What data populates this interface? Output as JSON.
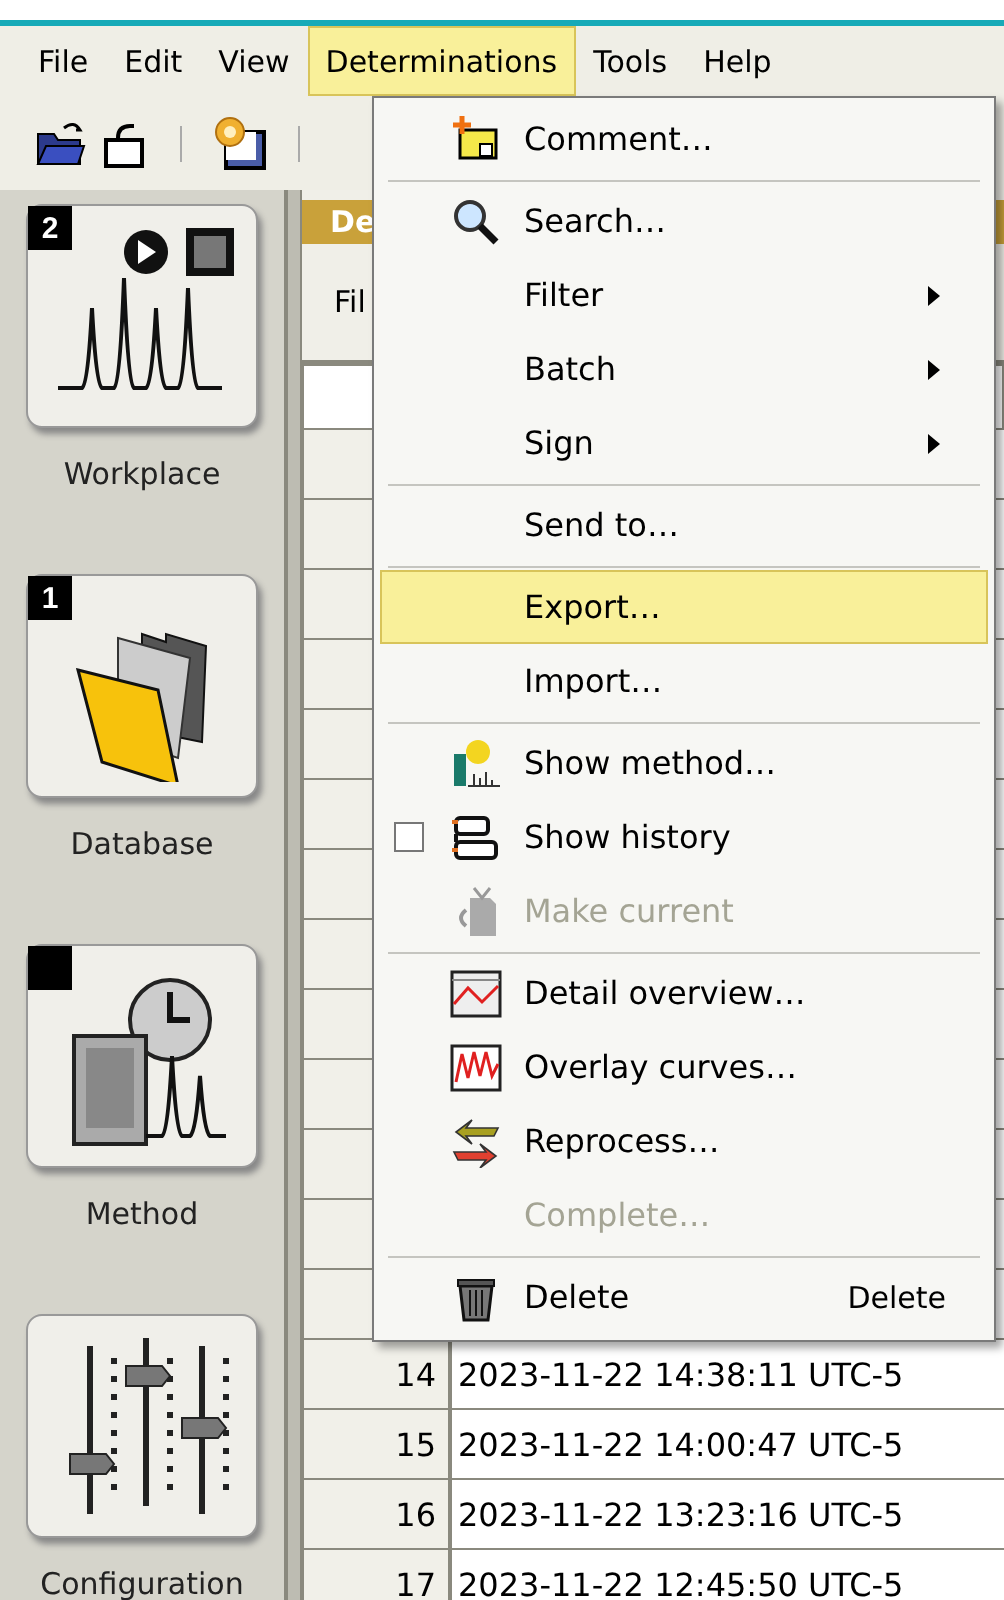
{
  "menubar": [
    {
      "label": "File",
      "selected": false
    },
    {
      "label": "Edit",
      "selected": false
    },
    {
      "label": "View",
      "selected": false
    },
    {
      "label": "Determinations",
      "selected": true
    },
    {
      "label": "Tools",
      "selected": false
    },
    {
      "label": "Help",
      "selected": false
    }
  ],
  "sidebar": {
    "items": [
      {
        "label": "Workplace",
        "kind": "workplace",
        "indicator": true,
        "badge": "2"
      },
      {
        "label": "Database",
        "kind": "database",
        "indicator": true,
        "badge": "1"
      },
      {
        "label": "Method",
        "kind": "method",
        "indicator": true
      },
      {
        "label": "Configuration",
        "kind": "configuration",
        "indicator": false
      }
    ]
  },
  "panel": {
    "tab_title": "De",
    "filter_label": "Fil"
  },
  "table": {
    "rows": [
      {
        "number": "14",
        "date": "2023-11-22 14:38:11 UTC-5"
      },
      {
        "number": "15",
        "date": "2023-11-22 14:00:47 UTC-5"
      },
      {
        "number": "16",
        "date": "2023-11-22 13:23:16 UTC-5"
      },
      {
        "number": "17",
        "date": "2023-11-22 12:45:50 UTC-5"
      }
    ]
  },
  "menu": {
    "items": [
      {
        "kind": "item",
        "label": "Comment…",
        "submenu": false,
        "disabled": false,
        "selected": false
      },
      {
        "kind": "separator"
      },
      {
        "kind": "item",
        "label": "Search…",
        "submenu": false,
        "disabled": false,
        "selected": false
      },
      {
        "kind": "item",
        "label": "Filter",
        "submenu": true,
        "disabled": false,
        "selected": false
      },
      {
        "kind": "item",
        "label": "Batch",
        "submenu": true,
        "disabled": false,
        "selected": false
      },
      {
        "kind": "item",
        "label": "Sign",
        "submenu": true,
        "disabled": false,
        "selected": false
      },
      {
        "kind": "separator"
      },
      {
        "kind": "item",
        "label": "Send to…",
        "submenu": false,
        "disabled": false,
        "selected": false
      },
      {
        "kind": "separator"
      },
      {
        "kind": "item",
        "label": "Export…",
        "submenu": false,
        "disabled": false,
        "selected": true
      },
      {
        "kind": "item",
        "label": "Import…",
        "submenu": false,
        "disabled": false,
        "selected": false
      },
      {
        "kind": "separator"
      },
      {
        "kind": "item",
        "label": "Show method…",
        "submenu": false,
        "disabled": false,
        "selected": false
      },
      {
        "kind": "item",
        "label": "Show history",
        "checked": false,
        "submenu": false,
        "disabled": false,
        "selected": false
      },
      {
        "kind": "item",
        "label": "Make current",
        "submenu": false,
        "disabled": true,
        "selected": false
      },
      {
        "kind": "separator"
      },
      {
        "kind": "item",
        "label": "Detail overview…",
        "submenu": false,
        "disabled": false,
        "selected": false
      },
      {
        "kind": "item",
        "label": "Overlay curves…",
        "submenu": false,
        "disabled": false,
        "selected": false
      },
      {
        "kind": "item",
        "label": "Reprocess…",
        "submenu": false,
        "disabled": false,
        "selected": false
      },
      {
        "kind": "item",
        "label": "Complete…",
        "submenu": false,
        "disabled": true,
        "selected": false
      },
      {
        "kind": "separator"
      },
      {
        "kind": "item",
        "label": "Delete",
        "shortcut": "Delete",
        "submenu": false,
        "disabled": false,
        "selected": false
      }
    ]
  }
}
